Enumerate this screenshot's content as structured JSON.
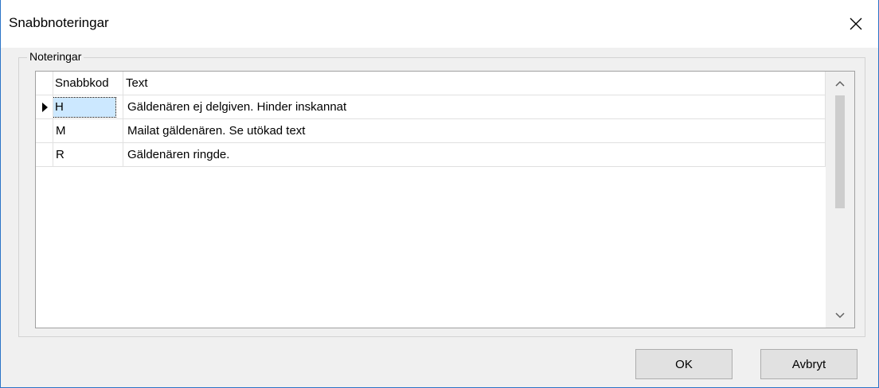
{
  "window": {
    "title": "Snabbnoteringar"
  },
  "icons": {
    "close": "close-icon",
    "scroll_up": "chevron-up-icon",
    "scroll_down": "chevron-down-icon",
    "current_row": "row-pointer-icon"
  },
  "group": {
    "label": "Noteringar"
  },
  "grid": {
    "columns": [
      "Snabbkod",
      "Text"
    ],
    "rows": [
      {
        "code": "H",
        "text": "Gäldenären ej delgiven. Hinder inskannat"
      },
      {
        "code": "M",
        "text": "Mailat gäldenären. Se utökad text"
      },
      {
        "code": "R",
        "text": "Gäldenären ringde."
      }
    ],
    "selected_row": 0,
    "scroll_position": 0
  },
  "buttons": {
    "ok": "OK",
    "cancel": "Avbryt"
  },
  "colors": {
    "window_border": "#2b74c7",
    "selection": "#cce8ff",
    "dialog_bg": "#f0f0f0"
  }
}
